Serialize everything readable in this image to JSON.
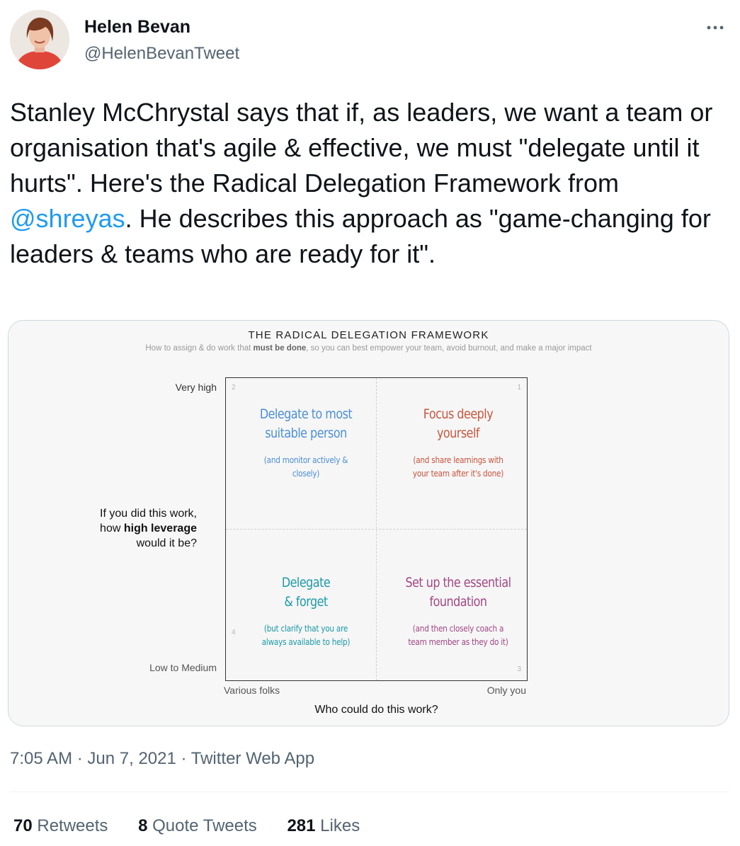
{
  "author": {
    "name": "Helen Bevan",
    "handle": "@HelenBevanTweet"
  },
  "tweet": {
    "text_before": "Stanley McChrystal says that if, as leaders, we want a team or organisation that's agile & effective, we must \"delegate until it hurts\". Here's the Radical Delegation Framework from ",
    "mention": "@shreyas",
    "text_after": ". He describes this approach as \"game-changing for leaders & teams who are ready for it\"."
  },
  "framework": {
    "title": "THE RADICAL DELEGATION FRAMEWORK",
    "subtitle_before": "How to assign & do work that ",
    "subtitle_bold": "must be done",
    "subtitle_after": ", so you can best empower your team, avoid burnout, and make a major impact",
    "y_axis": {
      "high": "Very high",
      "low": "Low to Medium",
      "question_line1": "If you did this work,",
      "question_line2_before": "how ",
      "question_line2_bold": "high leverage",
      "question_line3": "would it be?"
    },
    "x_axis": {
      "left": "Various folks",
      "right": "Only you",
      "question": "Who could do this work?"
    },
    "quadrants": {
      "q1": {
        "number": "1",
        "line1": "Focus deeply",
        "line2": "yourself",
        "note1": "(and share learnings with",
        "note2": "your team after it's done)",
        "color": "#c8553d"
      },
      "q2": {
        "number": "2",
        "line1": "Delegate to most",
        "line2": "suitable person",
        "note1": "(and monitor actively &",
        "note2": "closely)",
        "color": "#4a8fd6"
      },
      "q3": {
        "number": "3",
        "line1": "Set up the essential",
        "line2": "foundation",
        "note1": "(and then closely coach a",
        "note2": "team member as they do it)",
        "color": "#a14785"
      },
      "q4": {
        "number": "4",
        "line1": "Delegate",
        "line2": "& forget",
        "note1": "(but clarify that you are",
        "note2": "always available to help)",
        "color": "#1c9aa8"
      }
    }
  },
  "meta": {
    "time": "7:05 AM",
    "date": "Jun 7, 2021",
    "source": "Twitter Web App",
    "separator": "·"
  },
  "stats": {
    "retweets_count": "70",
    "retweets_label": "Retweets",
    "quotes_count": "8",
    "quotes_label": "Quote Tweets",
    "likes_count": "281",
    "likes_label": "Likes"
  },
  "icons": {
    "more": "more-horizontal-icon"
  },
  "colors": {
    "link": "#1d9bf0",
    "secondary_text": "#536471"
  }
}
